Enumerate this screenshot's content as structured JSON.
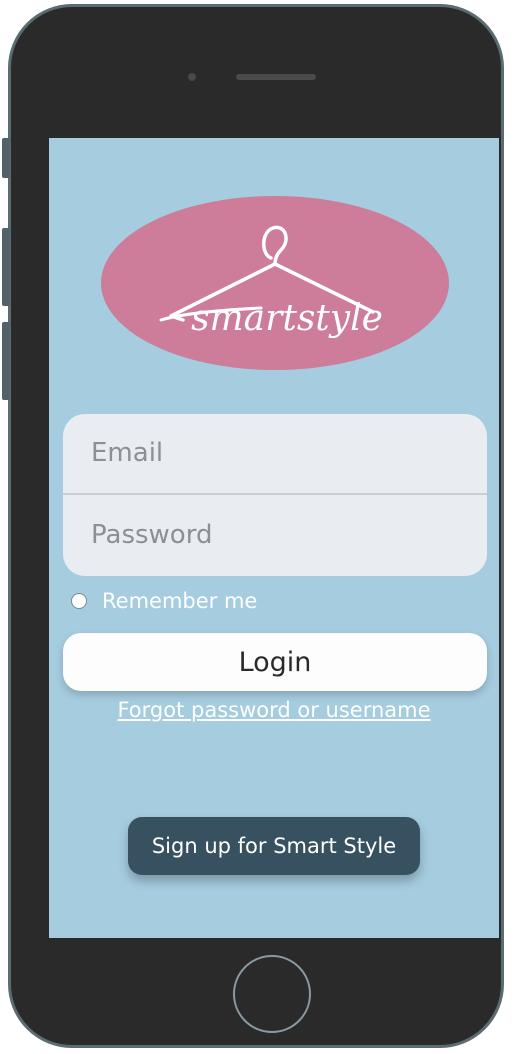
{
  "logo": {
    "text": "smartstyle",
    "icon": "hanger-icon"
  },
  "login_form": {
    "email_placeholder": "Email",
    "password_placeholder": "Password",
    "remember_label": "Remember me",
    "remember_checked": false,
    "login_label": "Login",
    "forgot_label": "Forgot password or username"
  },
  "signup": {
    "label": "Sign up for Smart Style"
  },
  "colors": {
    "screen_bg": "#a5ccdf",
    "logo_bg": "#cd7c99",
    "signup_bg": "#385161",
    "phone_body": "#2a2a2a"
  }
}
